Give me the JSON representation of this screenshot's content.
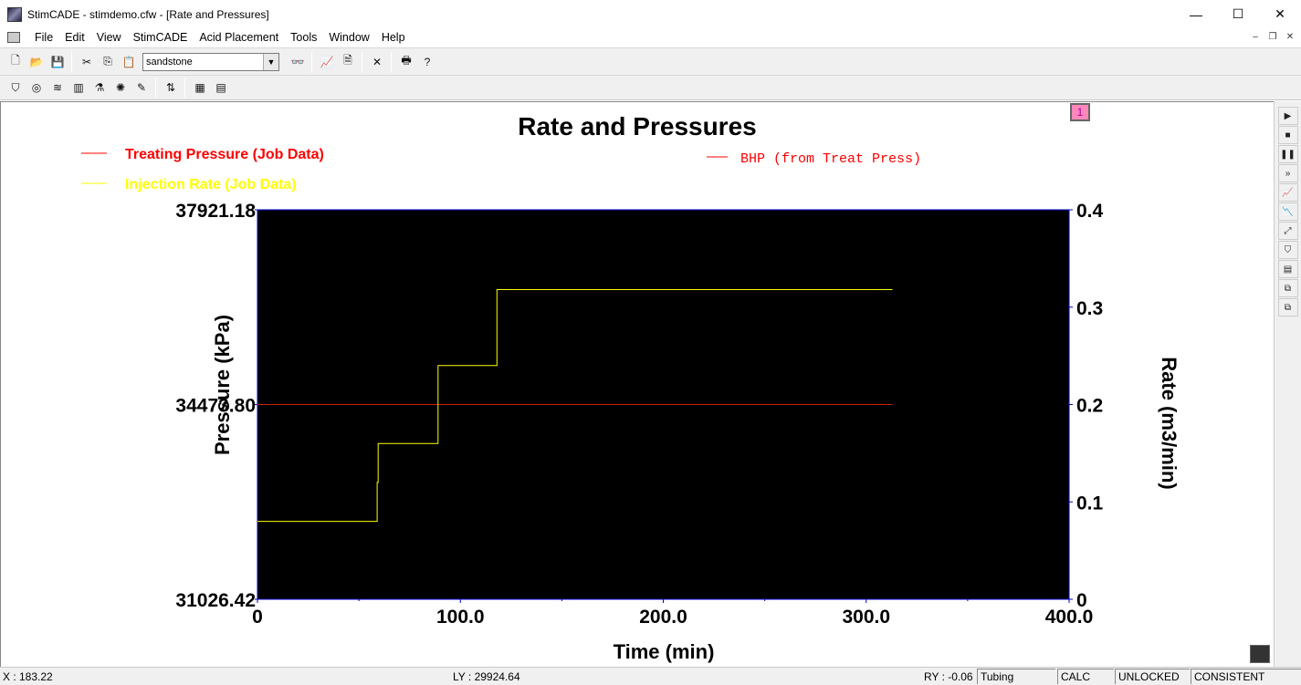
{
  "window": {
    "title": "StimCADE - stimdemo.cfw - [Rate and Pressures]",
    "min_glyph": "—",
    "max_glyph": "☐",
    "close_glyph": "✕"
  },
  "menu": [
    {
      "label": "File"
    },
    {
      "label": "Edit"
    },
    {
      "label": "View"
    },
    {
      "label": "StimCADE"
    },
    {
      "label": "Acid Placement"
    },
    {
      "label": "Tools"
    },
    {
      "label": "Window"
    },
    {
      "label": "Help"
    }
  ],
  "toolbar": {
    "formation_select": "sandstone"
  },
  "chart_data": {
    "type": "line",
    "title": "Rate and Pressures",
    "xlabel": "Time (min)",
    "ylabel_left": "Pressure (kPa)",
    "ylabel_right": "Rate (m3/min)",
    "xlim": [
      0,
      400
    ],
    "ylim_left": [
      31026.42,
      37921.18
    ],
    "ylim_right": [
      0,
      0.4
    ],
    "x_ticks": [
      "0",
      "100.0",
      "200.0",
      "300.0",
      "400.0"
    ],
    "y_left_ticks": [
      "31026.42",
      "34473.80",
      "37921.18"
    ],
    "y_right_ticks": [
      "0",
      "0.1",
      "0.2",
      "0.3",
      "0.4"
    ],
    "legend": [
      {
        "name": "Treating Pressure (Job Data)",
        "color": "#ff0000"
      },
      {
        "name": "Injection Rate (Job Data)",
        "color": "#ffff00"
      },
      {
        "name": "BHP (from Treat Press)",
        "color": "#ff0000"
      }
    ],
    "background": "#000000",
    "series": [
      {
        "name": "BHP (from Treat Press)",
        "axis": "left",
        "color": "#cc2200",
        "x": [
          0,
          313
        ],
        "y": [
          34473.8,
          34473.8
        ]
      },
      {
        "name": "Injection Rate (Job Data)",
        "axis": "right",
        "color": "#ffff00",
        "step": true,
        "x": [
          0,
          59,
          59,
          59.5,
          59.5,
          89,
          89,
          118,
          118,
          313
        ],
        "y": [
          0.08,
          0.08,
          0.12,
          0.12,
          0.16,
          0.16,
          0.24,
          0.24,
          0.318,
          0.318
        ]
      }
    ]
  },
  "page_indicator": "1",
  "status": {
    "x": "X : 183.22",
    "ly": "LY : 29924.64",
    "ry": "RY : -0.06",
    "tubing": "Tubing",
    "calc": "CALC",
    "unlocked": "UNLOCKED",
    "consistent": "CONSISTENT"
  }
}
